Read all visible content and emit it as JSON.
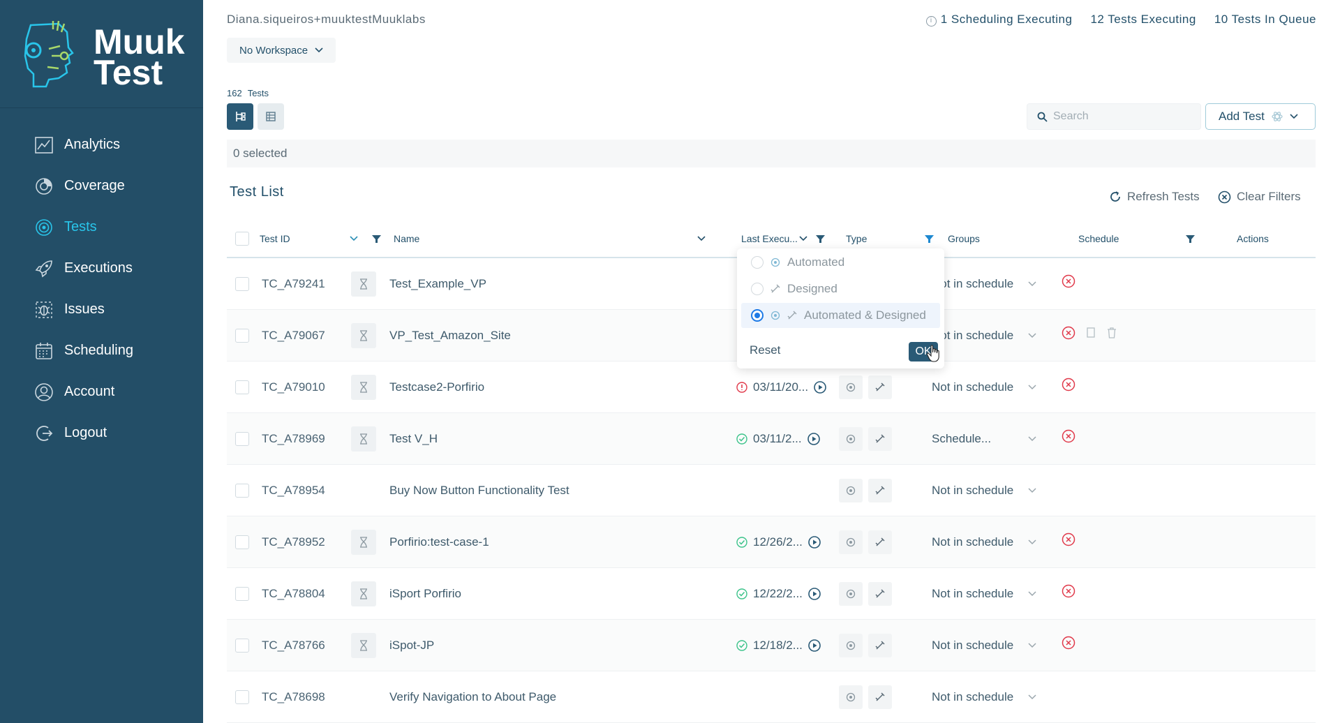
{
  "brand": {
    "line1": "Muuk",
    "line2": "Test"
  },
  "sidebar": {
    "items": [
      {
        "label": "Analytics",
        "icon": "analytics-icon"
      },
      {
        "label": "Coverage",
        "icon": "coverage-icon"
      },
      {
        "label": "Tests",
        "icon": "tests-icon",
        "active": true
      },
      {
        "label": "Executions",
        "icon": "rocket-icon"
      },
      {
        "label": "Issues",
        "icon": "bug-icon"
      },
      {
        "label": "Scheduling",
        "icon": "calendar-icon"
      },
      {
        "label": "Account",
        "icon": "user-icon"
      },
      {
        "label": "Logout",
        "icon": "logout-icon"
      }
    ]
  },
  "header": {
    "user": "Diana.siqueiros+muuktestMuuklabs",
    "status": {
      "scheduling": "1 Scheduling Executing",
      "tests_executing": "12 Tests Executing",
      "queue": "10 Tests In Queue"
    },
    "workspace": "No Workspace"
  },
  "toolbar": {
    "count": "162",
    "count_label": "Tests",
    "search_placeholder": "Search",
    "add_test": "Add Test",
    "selected": "0 selected"
  },
  "list": {
    "title": "Test List",
    "refresh": "Refresh Tests",
    "clear": "Clear Filters",
    "columns": {
      "test_id": "Test ID",
      "name": "Name",
      "last_exec": "Last Execu...",
      "type": "Type",
      "groups": "Groups",
      "schedule": "Schedule",
      "actions": "Actions"
    },
    "rows": [
      {
        "id": "TC_A79241",
        "name": "Test_Example_VP",
        "exec": "",
        "status": "",
        "schedule": "Not in schedule",
        "hg": true,
        "actions": 1
      },
      {
        "id": "TC_A79067",
        "name": "VP_Test_Amazon_Site",
        "exec": "",
        "status": "",
        "schedule": "Not in schedule",
        "hg": true,
        "actions": 3
      },
      {
        "id": "TC_A79010",
        "name": "Testcase2-Porfirio",
        "exec": "03/11/20...",
        "status": "error",
        "schedule": "Not in schedule",
        "hg": true,
        "actions": 1
      },
      {
        "id": "TC_A78969",
        "name": "Test V_H",
        "exec": "03/11/2...",
        "status": "ok",
        "schedule": "Schedule...",
        "hg": true,
        "actions": 1
      },
      {
        "id": "TC_A78954",
        "name": "Buy Now Button Functionality Test",
        "exec": "",
        "status": "",
        "schedule": "Not in schedule",
        "hg": false,
        "actions": 0
      },
      {
        "id": "TC_A78952",
        "name": "Porfirio:test-case-1",
        "exec": "12/26/2...",
        "status": "ok",
        "schedule": "Not in schedule",
        "hg": true,
        "actions": 1
      },
      {
        "id": "TC_A78804",
        "name": "iSport Porfirio",
        "exec": "12/22/2...",
        "status": "ok",
        "schedule": "Not in schedule",
        "hg": true,
        "actions": 1
      },
      {
        "id": "TC_A78766",
        "name": "iSpot-JP",
        "exec": "12/18/2...",
        "status": "ok",
        "schedule": "Not in schedule",
        "hg": true,
        "actions": 1
      },
      {
        "id": "TC_A78698",
        "name": "Verify Navigation to About Page",
        "exec": "",
        "status": "",
        "schedule": "Not in schedule",
        "hg": false,
        "actions": 0
      }
    ]
  },
  "type_filter": {
    "options": [
      "Automated",
      "Designed",
      "Automated & Designed"
    ],
    "selected": "Automated & Designed",
    "reset": "Reset",
    "ok": "OK"
  },
  "colors": {
    "sidebar": "#234e67",
    "accent": "#29c5ea",
    "error": "#e0394a",
    "ok": "#3cc38a",
    "primary": "#2a5a76"
  }
}
